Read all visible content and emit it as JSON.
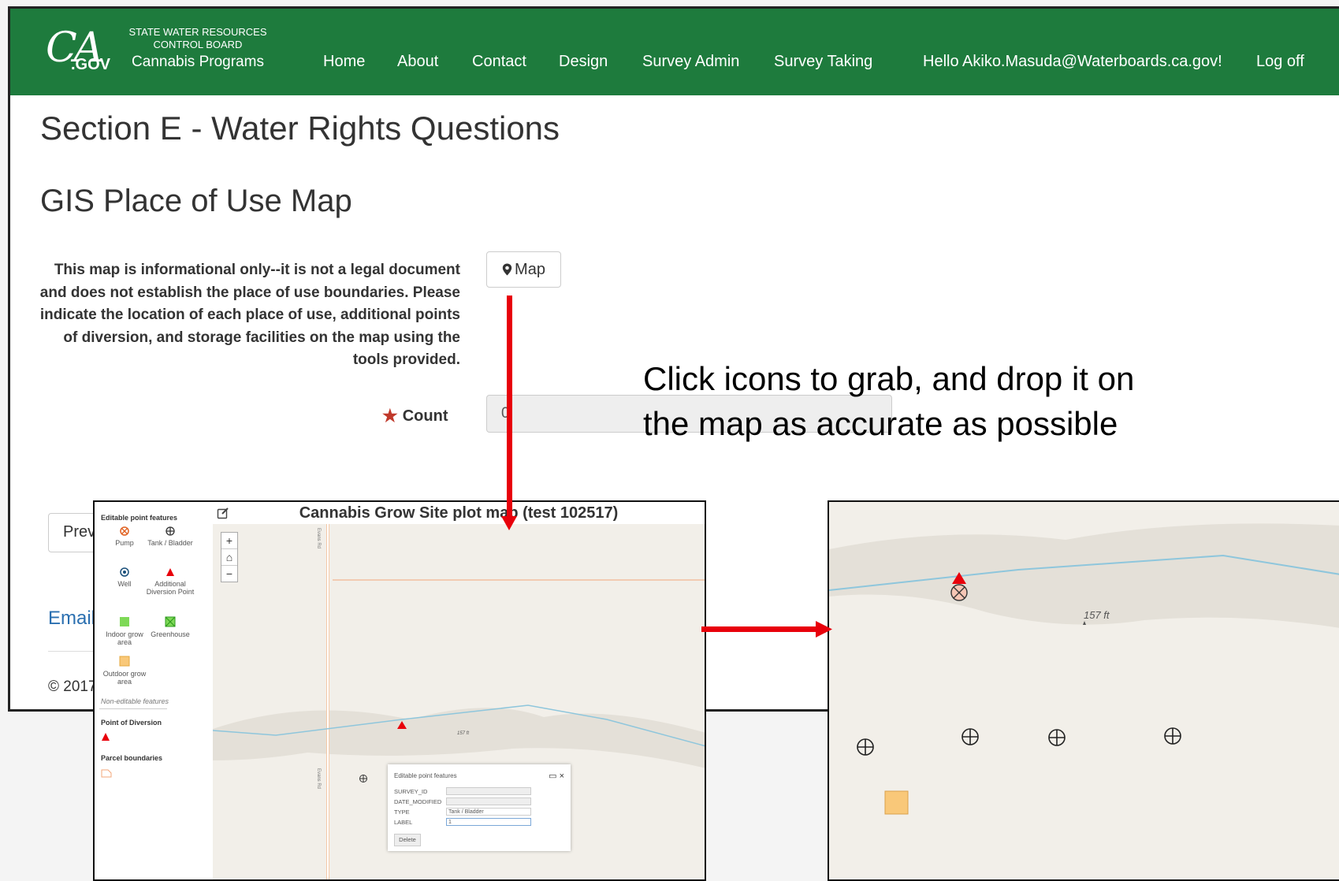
{
  "header": {
    "logo_ca": "CA",
    "logo_gov": ".GOV",
    "agency_line1": "STATE WATER RESOURCES",
    "agency_line2": "CONTROL BOARD",
    "agency_program": "Cannabis Programs",
    "nav": [
      "Home",
      "About",
      "Contact",
      "Design",
      "Survey Admin",
      "Survey Taking"
    ],
    "greeting": "Hello Akiko.Masuda@Waterboards.ca.gov!",
    "logoff": "Log off"
  },
  "page": {
    "section_title": "Section E - Water Rights Questions",
    "subsection_title": "GIS Place of Use Map",
    "info_text": "This map is informational only--it is not a legal document and does not establish the place of use boundaries. Please indicate the location of each place of use, additional points of diversion, and storage facilities on the map using the tools provided.",
    "map_button": "Map",
    "count_label": "Count",
    "count_value": "0",
    "prev_button": "Prev",
    "email_link": "Email",
    "copyright": "© 2017"
  },
  "callout": {
    "line1": "Click icons to grab, and drop it on",
    "line2": "the map as accurate as possible"
  },
  "map_panel": {
    "title": "Cannabis Grow Site plot map (test 102517)",
    "editable_header": "Editable point features",
    "legend_items": [
      {
        "label": "Pump",
        "icon": "pump-icon"
      },
      {
        "label": "Tank / Bladder",
        "icon": "tank-icon"
      },
      {
        "label": "Well",
        "icon": "well-icon"
      },
      {
        "label": "Additional Diversion Point",
        "icon": "diversion-icon"
      },
      {
        "label": "Indoor grow area",
        "icon": "indoor-grow-icon"
      },
      {
        "label": "Greenhouse",
        "icon": "greenhouse-icon"
      },
      {
        "label": "Outdoor grow area",
        "icon": "outdoor-grow-icon"
      }
    ],
    "non_editable_header": "Non-editable features",
    "pod_header": "Point of Diversion",
    "parcel_header": "Parcel boundaries",
    "road_label": "Evans Rd",
    "elevation_label": "157 ft",
    "popup": {
      "title": "Editable point features",
      "fields": [
        {
          "name": "SURVEY_ID",
          "value": ""
        },
        {
          "name": "DATE_MODIFIED",
          "value": ""
        },
        {
          "name": "TYPE",
          "value": "Tank / Bladder"
        },
        {
          "name": "LABEL",
          "value": "1"
        }
      ],
      "delete_button": "Delete"
    }
  },
  "zoom_map": {
    "elevation_label": "157 ft"
  },
  "colors": {
    "nav_green": "#1e7b3d",
    "arrow_red": "#e8000b",
    "pump_orange": "#e06020",
    "diversion_red": "#e8000b",
    "grow_green": "#7ed957",
    "outdoor_orange": "#f9c879",
    "river_blue": "#8ec6dc"
  }
}
